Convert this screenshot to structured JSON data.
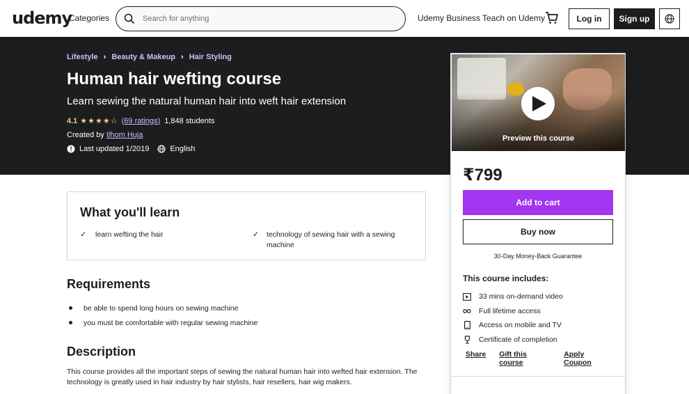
{
  "header": {
    "logo": "udemy",
    "categories": "Categories",
    "search_placeholder": "Search for anything",
    "business": "Udemy Business",
    "teach": "Teach on Udemy",
    "login": "Log in",
    "signup": "Sign up"
  },
  "course": {
    "breadcrumb": [
      "Lifestyle",
      "Beauty & Makeup",
      "Hair Styling"
    ],
    "title": "Human hair wefting course",
    "subtitle": "Learn sewing the natural human hair into weft hair extension",
    "rating": "4.1",
    "stars": "★★★★☆",
    "ratings_count": "(69 ratings)",
    "students": "1,848 students",
    "created_by_label": "Created by",
    "author": "Ilhom Huja",
    "last_updated": "Last updated 1/2019",
    "language": "English"
  },
  "sidebar": {
    "preview_label": "Preview this course",
    "price": "₹799",
    "add_to_cart": "Add to cart",
    "buy_now": "Buy now",
    "guarantee": "30-Day Money-Back Guarantee",
    "includes_title": "This course includes:",
    "includes": [
      {
        "icon": "video-icon",
        "label": "33 mins on-demand video"
      },
      {
        "icon": "infinity-icon",
        "label": "Full lifetime access"
      },
      {
        "icon": "mobile-icon",
        "label": "Access on mobile and TV"
      },
      {
        "icon": "trophy-icon",
        "label": "Certificate of completion"
      }
    ],
    "share": "Share",
    "gift": "Gift this course",
    "coupon": "Apply Coupon"
  },
  "learn": {
    "title": "What you'll learn",
    "items": [
      "learn wefting the hair",
      "technology of sewing hair with a sewing machine"
    ]
  },
  "requirements": {
    "title": "Requirements",
    "items": [
      "be able to spend long hours on sewing machine",
      "you must be comfortable with regular sewing machine"
    ]
  },
  "description": {
    "title": "Description",
    "text": "This course provides all the important steps of sewing the natural human hair into wefted hair extension. The technology is greatly used in hair industry by hair stylists, hair resellers, hair wig makers."
  },
  "colors": {
    "accent": "#a435f0",
    "hero_bg": "#1c1d1f",
    "link_light": "#cec0fc",
    "star": "#f3ca8c"
  }
}
